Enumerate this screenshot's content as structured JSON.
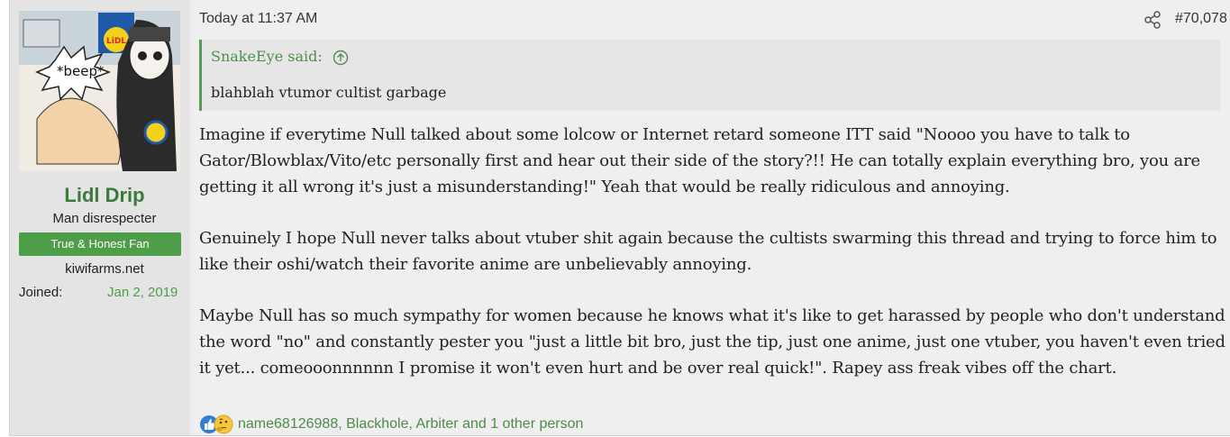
{
  "user": {
    "avatar_caption": "*beep*",
    "avatar_logo": "LiDL",
    "name": "Lidl Drip",
    "title": "Man disrespecter",
    "banner": "True & Honest Fan",
    "site": "kiwifarms.net",
    "joined_label": "Joined:",
    "joined_value": "Jan 2, 2019"
  },
  "post": {
    "timestamp": "Today at 11:37 AM",
    "number": "#70,078",
    "quote": {
      "author": "SnakeEye said:",
      "text": "blahblah vtumor cultist garbage"
    },
    "paragraphs": [
      "Imagine if everytime Null talked about some lolcow or Internet retard someone ITT said \"Noooo you have to talk to Gator/Blowblax/Vito/etc personally first and hear out their side of the story?!! He can totally explain everything bro, you are getting it all wrong it's just a misunderstanding!\" Yeah that would be really ridiculous and annoying.",
      "Genuinely I hope Null never talks about vtuber shit again because the cultists swarming this thread and trying to force him to like their oshi/watch their favorite anime are unbelievably annoying.",
      "Maybe Null has so much sympathy for women because he knows what it's like to get harassed by people who don't understand the word \"no\" and constantly pester you \"just a little bit bro, just the tip, just one anime, just one vtuber, you haven't even tried it yet... comeooonnnnnn I promise it won't even hurt and be over real quick!\". Rapey ass freak vibes off the chart."
    ],
    "reactions": {
      "icons": [
        "like-icon",
        "thinking-icon"
      ],
      "names": [
        "name68126988",
        "Blackhole",
        "Arbiter"
      ],
      "comma": ", ",
      "tail": " and 1 other person"
    }
  },
  "colors": {
    "accent_green": "#4e9d48",
    "username_green": "#3c7a3a",
    "background": "#efefef",
    "sidebar": "#e4e4e4"
  }
}
